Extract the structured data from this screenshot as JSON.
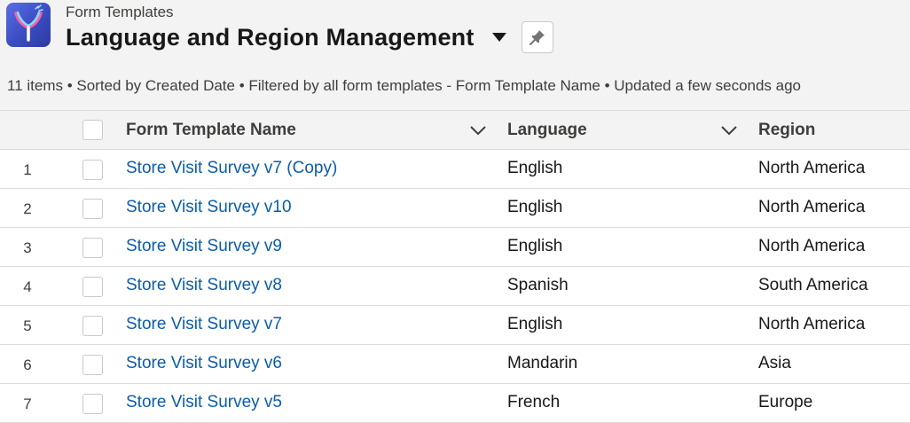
{
  "header": {
    "app_icon": "form-templates-app-icon",
    "object_label": "Form Templates",
    "list_title": "Language and Region Management",
    "dropdown_icon": "caret-down-icon",
    "pin_icon": "pin-icon",
    "info": "11 items • Sorted by Created Date • Filtered by all form templates - Form Template Name • Updated a few seconds ago"
  },
  "table": {
    "columns": [
      {
        "label": "Form Template Name",
        "chevron": "chevron-down-icon"
      },
      {
        "label": "Language",
        "chevron": "chevron-down-icon"
      },
      {
        "label": "Region"
      }
    ],
    "rows": [
      {
        "num": "1",
        "name": "Store Visit Survey v7 (Copy)",
        "language": "English",
        "region": "North America"
      },
      {
        "num": "2",
        "name": "Store Visit Survey v10",
        "language": "English",
        "region": "North America"
      },
      {
        "num": "3",
        "name": "Store Visit Survey v9",
        "language": "English",
        "region": "North America"
      },
      {
        "num": "4",
        "name": "Store Visit Survey v8",
        "language": "Spanish",
        "region": "South America"
      },
      {
        "num": "5",
        "name": "Store Visit Survey v7",
        "language": "English",
        "region": "North America"
      },
      {
        "num": "6",
        "name": "Store Visit Survey v6",
        "language": "Mandarin",
        "region": "Asia"
      },
      {
        "num": "7",
        "name": "Store Visit Survey v5",
        "language": "French",
        "region": "Europe"
      }
    ]
  },
  "colors": {
    "link": "#0b5cab",
    "header_bg": "#f3f3f3",
    "border": "#dddbda"
  }
}
